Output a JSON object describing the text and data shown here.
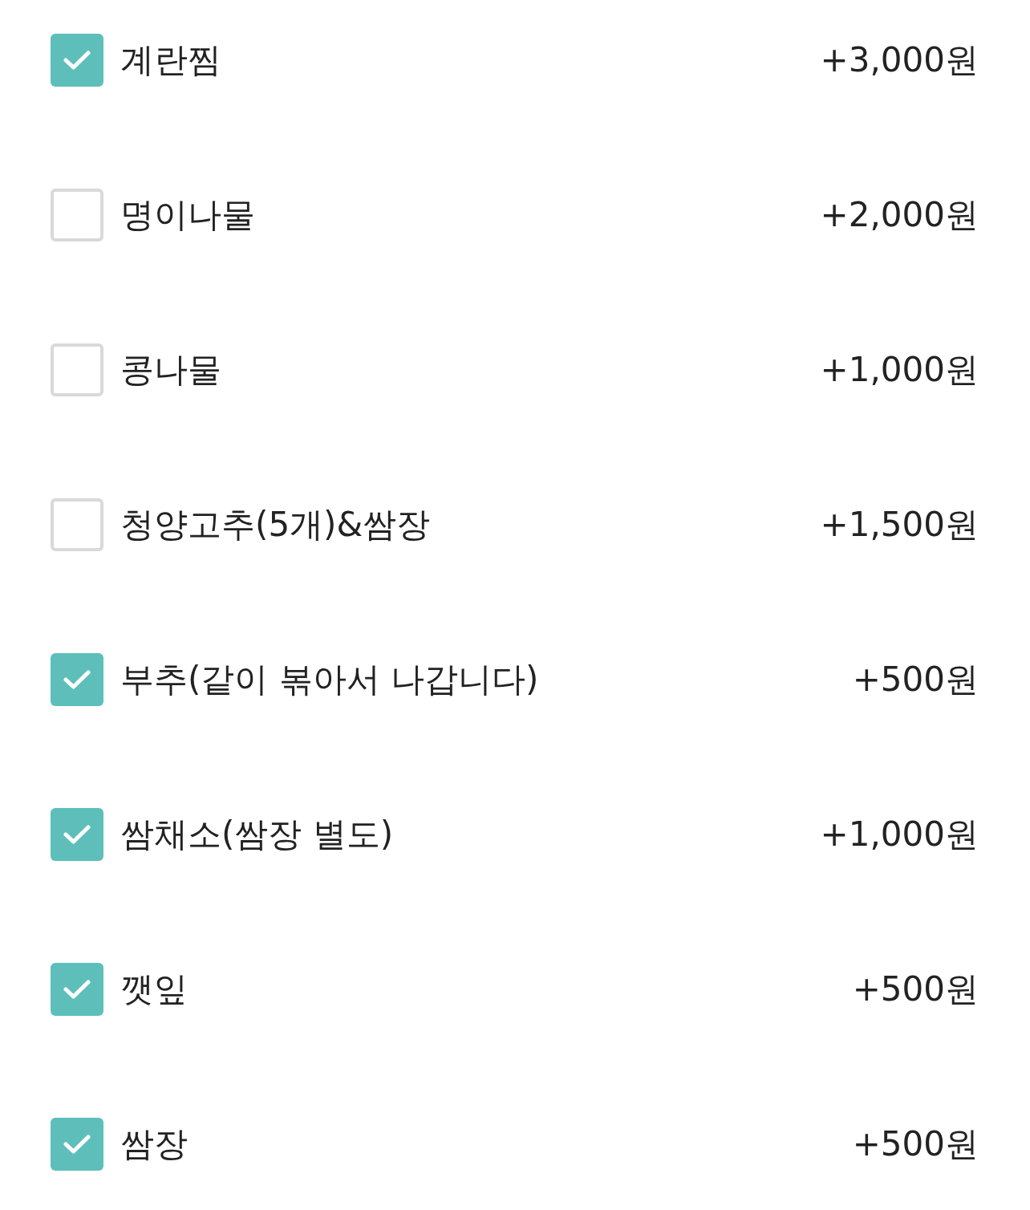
{
  "options": [
    {
      "label": "계란찜",
      "price": "+3,000원",
      "checked": true
    },
    {
      "label": "명이나물",
      "price": "+2,000원",
      "checked": false
    },
    {
      "label": "콩나물",
      "price": "+1,000원",
      "checked": false
    },
    {
      "label": "청양고추(5개)&쌈장",
      "price": "+1,500원",
      "checked": false
    },
    {
      "label": "부추(같이 볶아서 나갑니다)",
      "price": "+500원",
      "checked": true
    },
    {
      "label": "쌈채소(쌈장 별도)",
      "price": "+1,000원",
      "checked": true
    },
    {
      "label": "깻잎",
      "price": "+500원",
      "checked": true
    },
    {
      "label": "쌈장",
      "price": "+500원",
      "checked": true
    }
  ]
}
